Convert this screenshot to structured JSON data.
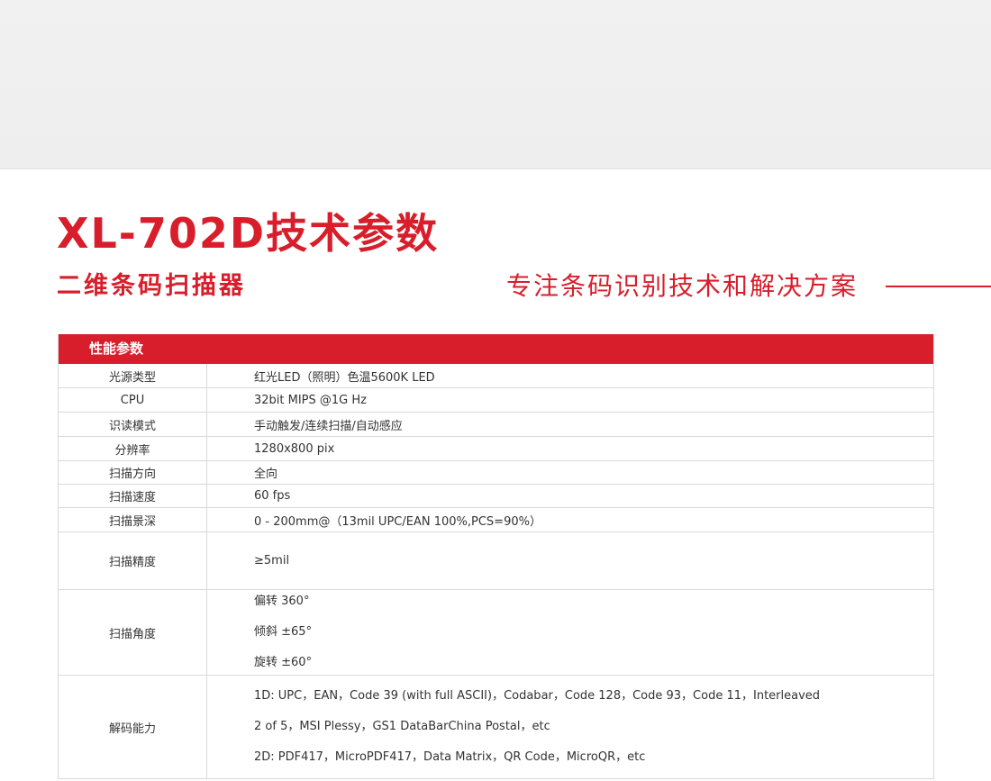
{
  "header": {
    "title": "XL-702D技术参数",
    "subtitle": "二维条码扫描器",
    "slogan": "专注条码识别技术和解决方案"
  },
  "colors": {
    "accent": "#d81e2b",
    "border": "#d9d9d9",
    "band": "#efefef"
  },
  "spec_table": {
    "section_title": "性能参数",
    "rows": [
      {
        "label": "光源类型",
        "values": [
          "红光LED（照明）色温5600K LED"
        ]
      },
      {
        "label": "CPU",
        "values": [
          "32bit MIPS @1G Hz"
        ]
      },
      {
        "label": "识读模式",
        "values": [
          "手动触发/连续扫描/自动感应"
        ]
      },
      {
        "label": "分辨率",
        "values": [
          "1280x800 pix"
        ]
      },
      {
        "label": "扫描方向",
        "values": [
          "全向"
        ]
      },
      {
        "label": "扫描速度",
        "values": [
          "60 fps"
        ]
      },
      {
        "label": "扫描景深",
        "values": [
          "0 - 200mm@（13mil UPC/EAN 100%,PCS=90%）"
        ]
      },
      {
        "label": "扫描精度",
        "values": [
          "≥5mil"
        ]
      },
      {
        "label": "扫描角度",
        "values": [
          "偏转 360°",
          "倾斜 ±65°",
          "旋转 ±60°"
        ]
      },
      {
        "label": "解码能力",
        "values": [
          "1D: UPC，EAN，Code 39 (with full ASCII)，Codabar，Code 128，Code 93，Code 11，Interleaved",
          "2 of 5，MSI Plessy，GS1 DataBarChina Postal，etc",
          "2D: PDF417，MicroPDF417，Data Matrix，QR Code，MicroQR，etc"
        ]
      }
    ]
  }
}
